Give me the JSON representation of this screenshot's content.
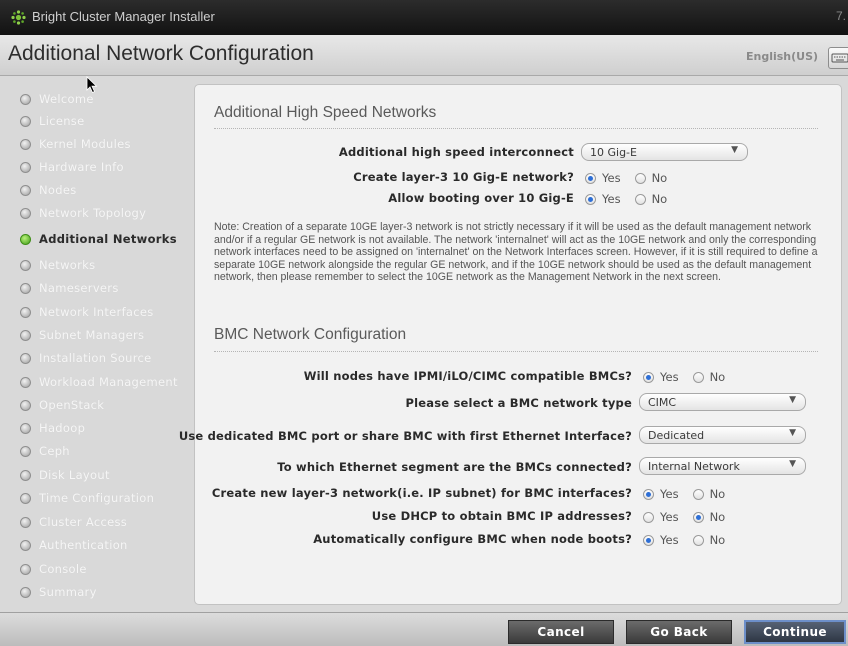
{
  "window": {
    "title": "Bright Cluster Manager Installer",
    "corner_text": "7."
  },
  "header": {
    "title": "Additional Network Configuration",
    "language": "English(US)"
  },
  "sidebar": {
    "items": [
      {
        "label": "Welcome",
        "active": false
      },
      {
        "label": "License",
        "active": false
      },
      {
        "label": "Kernel Modules",
        "active": false
      },
      {
        "label": "Hardware Info",
        "active": false
      },
      {
        "label": "Nodes",
        "active": false
      },
      {
        "label": "Network Topology",
        "active": false
      },
      {
        "label": "Additional Networks",
        "active": true
      },
      {
        "label": "Networks",
        "active": false
      },
      {
        "label": "Nameservers",
        "active": false
      },
      {
        "label": "Network Interfaces",
        "active": false
      },
      {
        "label": "Subnet Managers",
        "active": false
      },
      {
        "label": "Installation Source",
        "active": false
      },
      {
        "label": "Workload Management",
        "active": false
      },
      {
        "label": "OpenStack",
        "active": false
      },
      {
        "label": "Hadoop",
        "active": false
      },
      {
        "label": "Ceph",
        "active": false
      },
      {
        "label": "Disk Layout",
        "active": false
      },
      {
        "label": "Time Configuration",
        "active": false
      },
      {
        "label": "Cluster Access",
        "active": false
      },
      {
        "label": "Authentication",
        "active": false
      },
      {
        "label": "Console",
        "active": false
      },
      {
        "label": "Summary",
        "active": false
      }
    ]
  },
  "hs": {
    "title": "Additional High Speed Networks",
    "interconnect_label": "Additional high speed interconnect",
    "interconnect_value": "10 Gig-E",
    "create_label": "Create layer-3 10 Gig-E network?",
    "booting_label": "Allow booting over 10 Gig-E",
    "note": "Note: Creation of a separate 10GE layer-3 network is not strictly necessary if it will be used as the default management network and/or if a regular GE network is not available. The network 'internalnet' will act as the 10GE network and only the corresponding network interfaces need to be assigned on 'internalnet' on the Network Interfaces screen. However, if it is still required to define a separate 10GE network alongside the regular GE network, and if the 10GE network should be used as the default management network, then please remember to select the 10GE network as the Management Network in the next screen."
  },
  "bmc": {
    "title": "BMC Network Configuration",
    "compatible_label": "Will nodes have IPMI/iLO/CIMC compatible BMCs?",
    "type_label": "Please select a BMC network type",
    "type_value": "CIMC",
    "port_label": "Use dedicated BMC port or share BMC with first Ethernet Interface?",
    "port_value": "Dedicated",
    "segment_label": "To which Ethernet segment are the BMCs connected?",
    "segment_value": "Internal Network",
    "subnet_label": "Create new layer-3 network(i.e. IP subnet) for BMC interfaces?",
    "dhcp_label": "Use DHCP to obtain BMC IP addresses?",
    "autoconf_label": "Automatically configure BMC when node boots?"
  },
  "radio": {
    "yes": "Yes",
    "no": "No"
  },
  "answers": {
    "create_10g": "Yes",
    "boot_10g": "Yes",
    "bmc_compatible": "Yes",
    "bmc_subnet": "Yes",
    "bmc_dhcp": "No",
    "bmc_autoconf": "Yes"
  },
  "footer": {
    "cancel": "Cancel",
    "back": "Go Back",
    "continue": "Continue"
  },
  "icons": {
    "logo": "bright-logo-icon",
    "keyboard": "keyboard-icon",
    "pointer": "mouse-pointer-icon"
  },
  "colors": {
    "active_dot": "#4caf1f",
    "radio_selected": "#2e6fd6",
    "title_bar": "#1a1a1a"
  }
}
